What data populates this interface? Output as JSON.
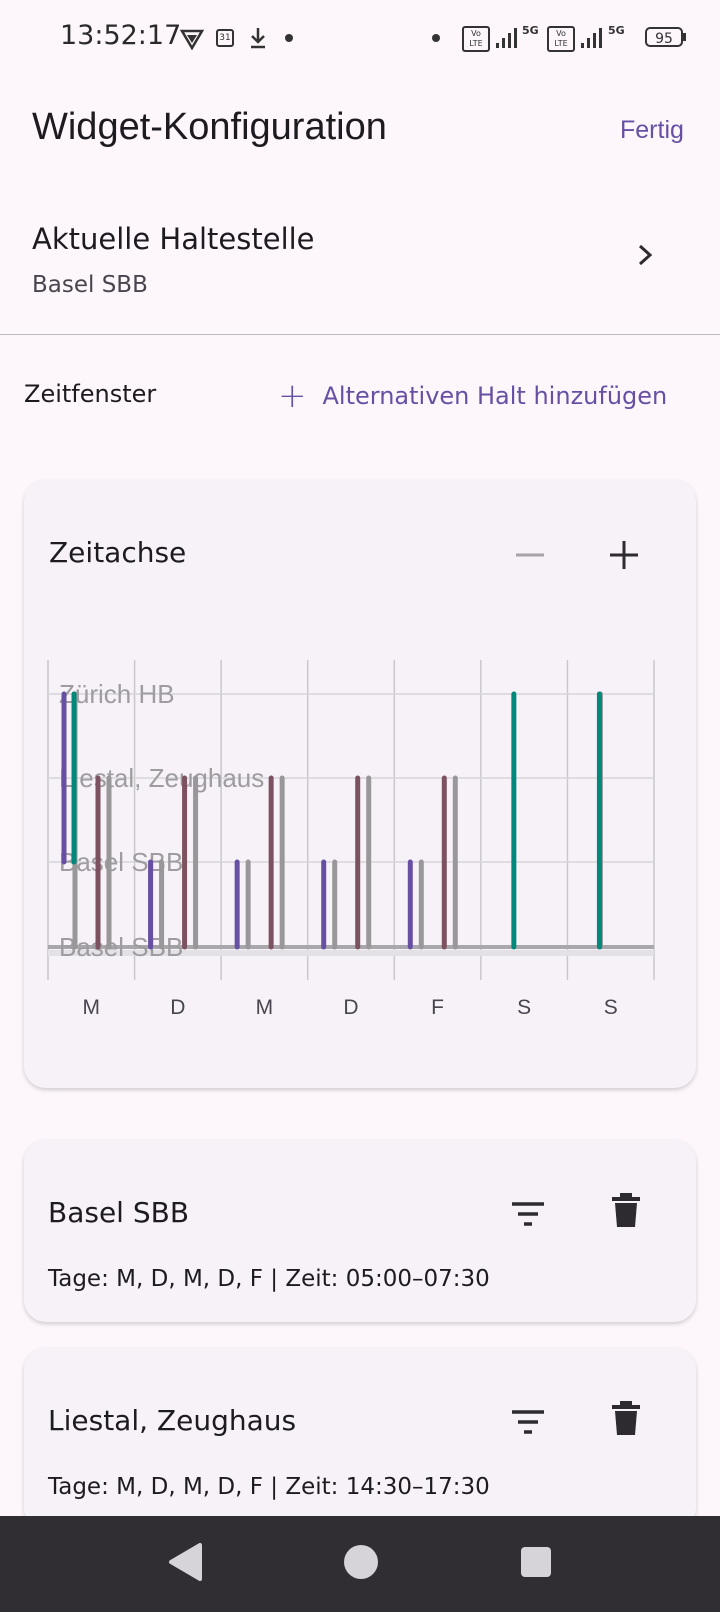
{
  "status_bar": {
    "time": "13:52:17",
    "calendar_day": "31",
    "volte": "Vo LTE",
    "network": "5G",
    "battery": "95"
  },
  "header": {
    "title": "Widget-Konfiguration",
    "done_label": "Fertig"
  },
  "current_stop": {
    "label": "Aktuelle Haltestelle",
    "value": "Basel SBB"
  },
  "time_window": {
    "label": "Zeitfenster",
    "add_alternative_label": "Alternativen Halt hinzufügen"
  },
  "timeline": {
    "title": "Zeitachse",
    "colors": {
      "basel": "#6750a4",
      "liestal": "#7d5260",
      "alt": "#999799",
      "zurich": "#00897b"
    }
  },
  "chart_data": {
    "type": "bar",
    "categories": [
      "M",
      "D",
      "M",
      "D",
      "F",
      "S",
      "S"
    ],
    "stops": [
      "Zürich HB",
      "Liestal, Zeughaus",
      "Basel SBB",
      "Basel SBB"
    ],
    "bars": [
      {
        "day": 0,
        "color": "basel",
        "from": 2,
        "to": 0
      },
      {
        "day": 0,
        "color": "alt",
        "from": 3,
        "to": 0
      },
      {
        "day": 0,
        "color": "zurich",
        "from": 2,
        "to": 0
      },
      {
        "day": 0,
        "color": "liestal",
        "from": 3,
        "to": 1
      },
      {
        "day": 0,
        "color": "alt",
        "from": 3,
        "to": 1
      },
      {
        "day": 1,
        "color": "basel",
        "from": 3,
        "to": 2
      },
      {
        "day": 1,
        "color": "alt",
        "from": 3,
        "to": 2
      },
      {
        "day": 1,
        "color": "liestal",
        "from": 3,
        "to": 1
      },
      {
        "day": 1,
        "color": "alt",
        "from": 3,
        "to": 1
      },
      {
        "day": 2,
        "color": "basel",
        "from": 3,
        "to": 2
      },
      {
        "day": 2,
        "color": "alt",
        "from": 3,
        "to": 2
      },
      {
        "day": 2,
        "color": "liestal",
        "from": 3,
        "to": 1
      },
      {
        "day": 2,
        "color": "alt",
        "from": 3,
        "to": 1
      },
      {
        "day": 3,
        "color": "basel",
        "from": 3,
        "to": 2
      },
      {
        "day": 3,
        "color": "alt",
        "from": 3,
        "to": 2
      },
      {
        "day": 3,
        "color": "liestal",
        "from": 3,
        "to": 1
      },
      {
        "day": 3,
        "color": "alt",
        "from": 3,
        "to": 1
      },
      {
        "day": 4,
        "color": "basel",
        "from": 3,
        "to": 2
      },
      {
        "day": 4,
        "color": "alt",
        "from": 3,
        "to": 2
      },
      {
        "day": 4,
        "color": "liestal",
        "from": 3,
        "to": 1
      },
      {
        "day": 4,
        "color": "alt",
        "from": 3,
        "to": 1
      },
      {
        "day": 5,
        "color": "zurich",
        "from": 3,
        "to": 0
      },
      {
        "day": 6,
        "color": "alt",
        "from": 3,
        "to": 0
      },
      {
        "day": 6,
        "color": "zurich",
        "from": 3,
        "to": 0
      }
    ],
    "grid": true
  },
  "entries": [
    {
      "title": "Basel SBB",
      "meta": "Tage: M, D, M, D, F | Zeit: 05:00–07:30"
    },
    {
      "title": "Liestal, Zeughaus",
      "meta": "Tage: M, D, M, D, F | Zeit: 14:30–17:30"
    }
  ]
}
